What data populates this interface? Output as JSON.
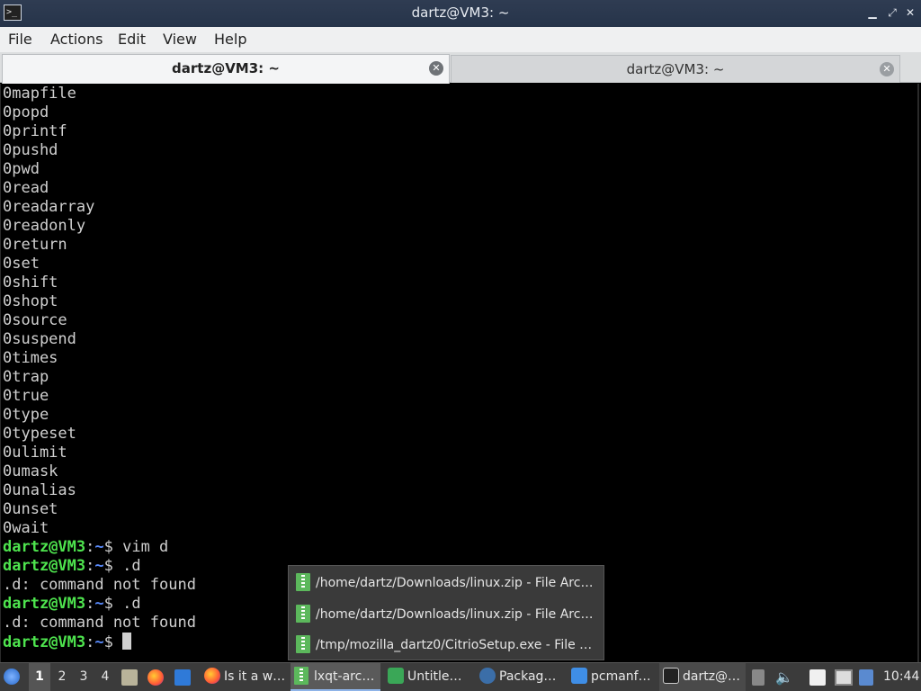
{
  "window": {
    "title": "dartz@VM3: ~",
    "controls": {
      "minimize": "▁",
      "maximize": "⤢",
      "close": "✕"
    }
  },
  "menubar": {
    "items": [
      "File",
      "Actions",
      "Edit",
      "View",
      "Help"
    ]
  },
  "tabs": [
    {
      "label": "dartz@VM3: ~",
      "active": true
    },
    {
      "label": "dartz@VM3: ~",
      "active": false
    }
  ],
  "terminal": {
    "output_lines": [
      "0mapfile",
      "0popd",
      "0printf",
      "0pushd",
      "0pwd",
      "0read",
      "0readarray",
      "0readonly",
      "0return",
      "0set",
      "0shift",
      "0shopt",
      "0source",
      "0suspend",
      "0times",
      "0trap",
      "0true",
      "0type",
      "0typeset",
      "0ulimit",
      "0umask",
      "0unalias",
      "0unset",
      "0wait"
    ],
    "prompt_user": "dartz@VM3",
    "prompt_sep": ":",
    "prompt_path": "~",
    "prompt_end": "$ ",
    "session": [
      {
        "type": "prompt",
        "cmd": "vim d"
      },
      {
        "type": "prompt",
        "cmd": ".d"
      },
      {
        "type": "output",
        "text": ".d: command not found"
      },
      {
        "type": "prompt",
        "cmd": ".d"
      },
      {
        "type": "output",
        "text": ".d: command not found"
      },
      {
        "type": "prompt",
        "cmd": ""
      }
    ]
  },
  "taskbar_popup": {
    "items": [
      "/home/dartz/Downloads/linux.zip - File Arc…",
      "/home/dartz/Downloads/linux.zip - File Arc…",
      "/tmp/mozilla_dartz0/CitrioSetup.exe - File …"
    ]
  },
  "panel": {
    "workspaces": [
      "1",
      "2",
      "3",
      "4"
    ],
    "active_workspace": "1",
    "tasks": [
      {
        "label": "Is it a w…",
        "icon": "firefox-icon"
      },
      {
        "label": "lxqt-arc…",
        "icon": "archive-icon",
        "active": true
      },
      {
        "label": "Untitle…",
        "icon": "spreadsheet-icon"
      },
      {
        "label": "Packag…",
        "icon": "package-icon"
      },
      {
        "label": "pcmanf…",
        "icon": "folder-icon"
      },
      {
        "label": "dartz@…",
        "icon": "terminal-icon"
      }
    ],
    "clock": "10:44"
  }
}
